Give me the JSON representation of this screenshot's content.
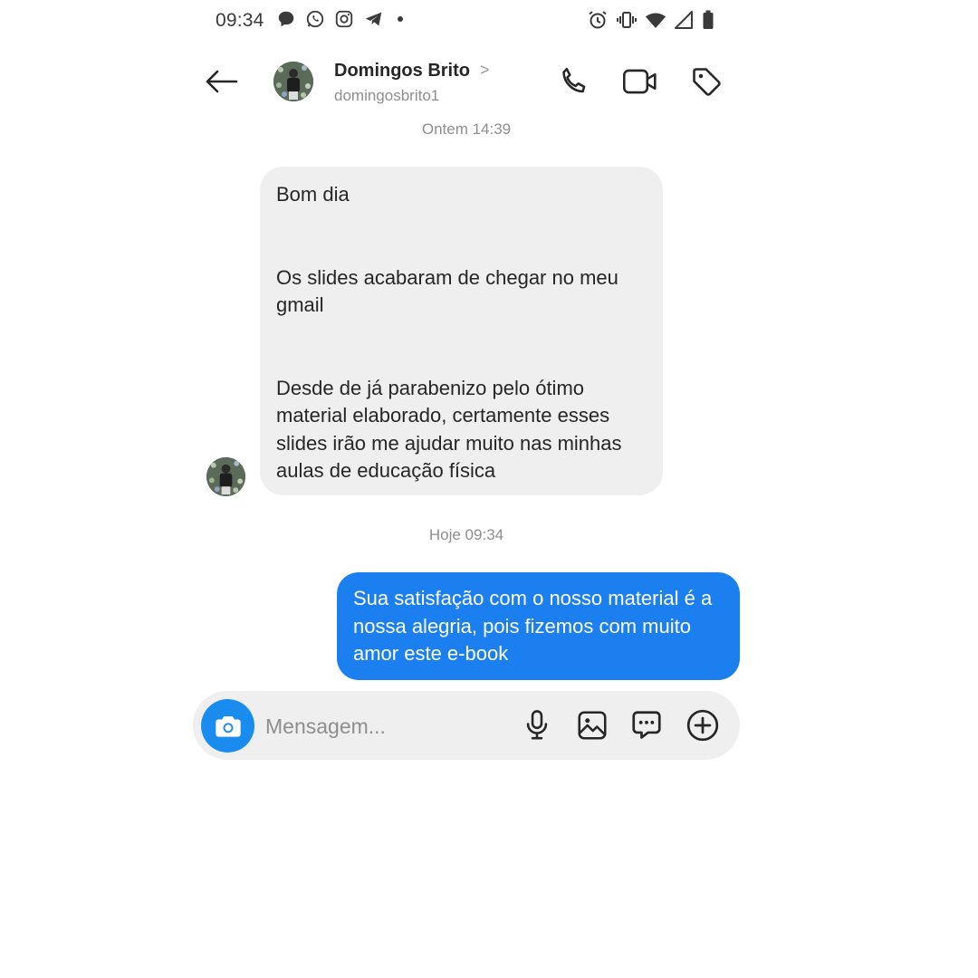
{
  "status_bar": {
    "time": "09:34",
    "left_icons": [
      "chat-bubble-icon",
      "whatsapp-icon",
      "instagram-icon",
      "telegram-icon",
      "dot-icon"
    ],
    "right_icons": [
      "alarm-icon",
      "vibrate-icon",
      "wifi-icon",
      "signal-icon",
      "battery-icon"
    ]
  },
  "header": {
    "contact_name": "Domingos Brito",
    "chevron": ">",
    "username": "domingosbrito1",
    "actions": [
      "phone-icon",
      "video-camera-icon",
      "tag-icon"
    ]
  },
  "conversation": {
    "timestamp_1": "Ontem 14:39",
    "received": {
      "line_1": "Bom dia",
      "line_2": "Os slides acabaram de chegar no meu gmail",
      "line_3": "Desde de já parabenizo pelo ótimo material elaborado, certamente esses slides irão me ajudar muito nas minhas aulas de educação física"
    },
    "timestamp_2": "Hoje 09:34",
    "sent": {
      "text": "Sua satisfação com o nosso material é a nossa alegria, pois fizemos com muito amor este e-book"
    }
  },
  "composer": {
    "placeholder": "Mensagem...",
    "icons": [
      "camera-icon",
      "microphone-icon",
      "gallery-icon",
      "sticker-icon",
      "plus-icon"
    ]
  },
  "colors": {
    "sent_bubble": "#1b7ff0",
    "received_bubble": "#efefef",
    "camera_button": "#1a8cf0",
    "composer_bg": "#efefef",
    "secondary_text": "#8e8e8e"
  }
}
